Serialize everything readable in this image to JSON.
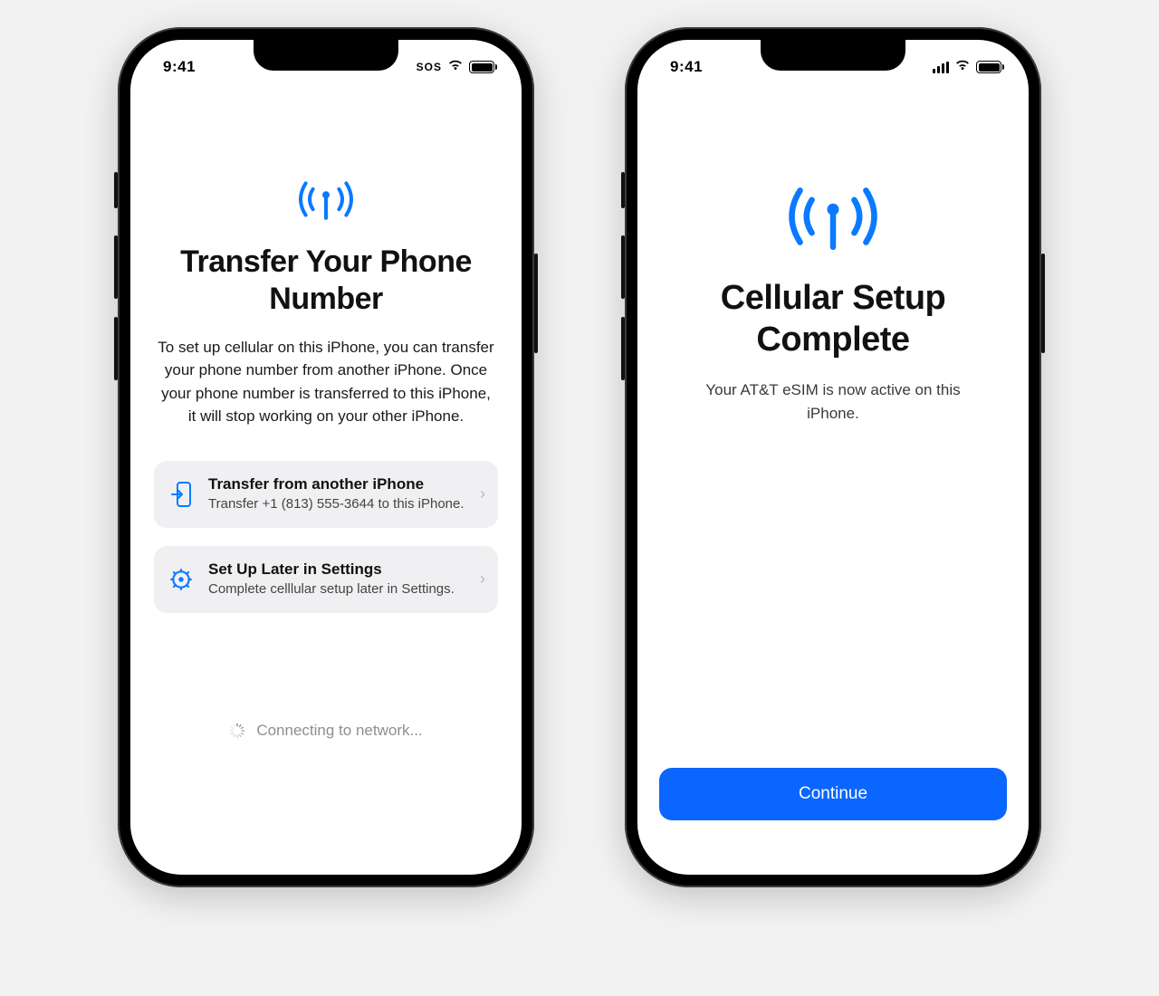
{
  "phoneA": {
    "status": {
      "time": "9:41",
      "sos": "SOS"
    },
    "title": "Transfer Your Phone Number",
    "subtitle": "To set up cellular on this iPhone, you can transfer your phone number from another iPhone. Once your phone number is transferred to this iPhone, it will stop working on your other iPhone.",
    "options": [
      {
        "title": "Transfer from another iPhone",
        "sub": "Transfer +1 (813) 555-3644 to this iPhone."
      },
      {
        "title": "Set Up Later in Settings",
        "sub": "Complete celllular setup later in Settings."
      }
    ],
    "connecting": "Connecting to network..."
  },
  "phoneB": {
    "status": {
      "time": "9:41"
    },
    "title": "Cellular Setup Complete",
    "subtitle": "Your AT&T eSIM is now active on this iPhone.",
    "continue_label": "Continue"
  }
}
